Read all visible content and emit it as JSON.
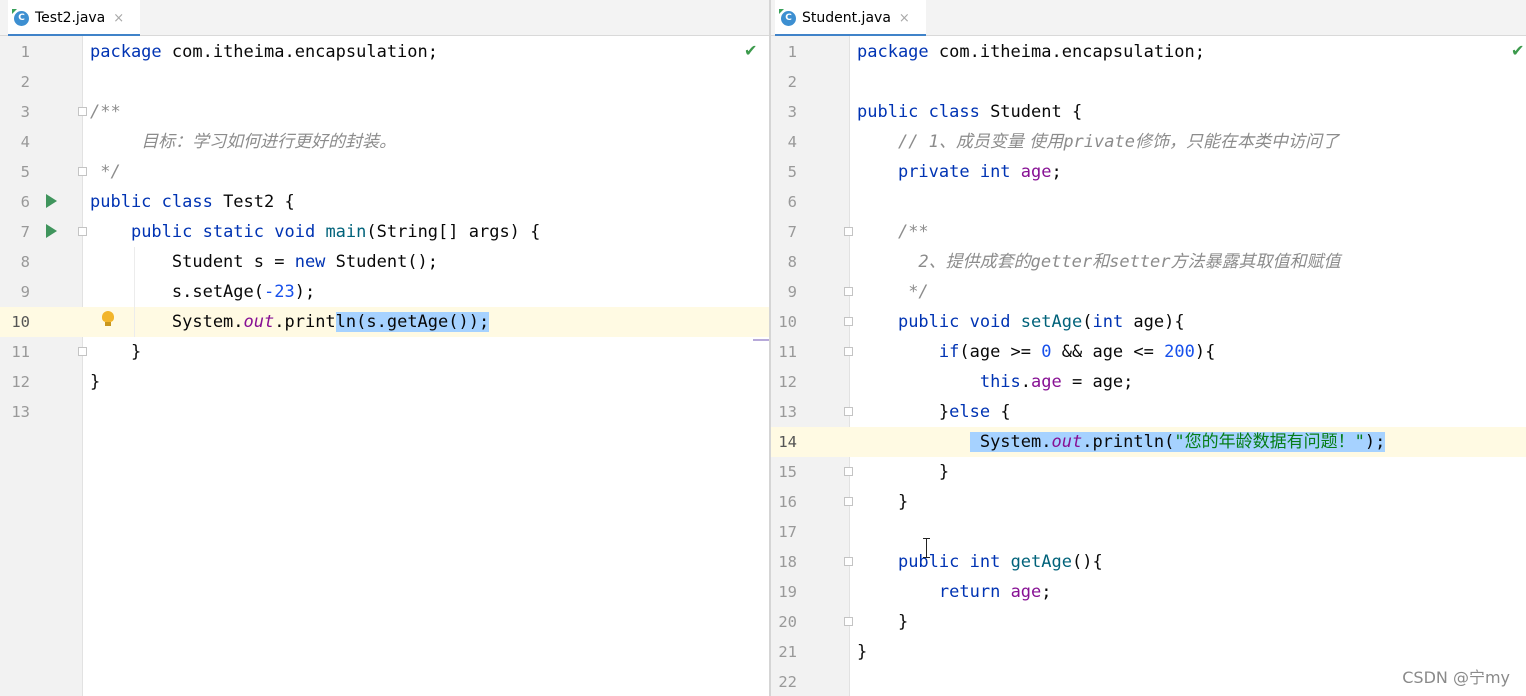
{
  "left": {
    "tab": {
      "label": "Test2.java",
      "close": "×"
    },
    "current_line": 10,
    "lines": [
      {
        "n": "1",
        "tokens": [
          {
            "c": "kw",
            "t": "package"
          },
          {
            "t": " com.itheima.encapsulation;"
          }
        ]
      },
      {
        "n": "2",
        "tokens": []
      },
      {
        "n": "3",
        "tokens": [
          {
            "c": "cm",
            "t": "/**"
          }
        ]
      },
      {
        "n": "4",
        "tokens": [
          {
            "c": "cm",
            "t": "     "
          },
          {
            "c": "cm cjk",
            "t": "目标：学习如何进行更好的封装。"
          }
        ]
      },
      {
        "n": "5",
        "tokens": [
          {
            "c": "cm",
            "t": " */"
          }
        ]
      },
      {
        "n": "6",
        "tokens": [
          {
            "c": "kw",
            "t": "public class"
          },
          {
            "t": " Test2 {"
          }
        ]
      },
      {
        "n": "7",
        "tokens": [
          {
            "t": "    "
          },
          {
            "c": "kw",
            "t": "public static void"
          },
          {
            "t": " "
          },
          {
            "c": "fn",
            "t": "main"
          },
          {
            "t": "(String[] args) {"
          }
        ]
      },
      {
        "n": "8",
        "tokens": [
          {
            "t": "        Student s = "
          },
          {
            "c": "kw",
            "t": "new"
          },
          {
            "t": " Student();"
          }
        ]
      },
      {
        "n": "9",
        "tokens": [
          {
            "t": "        s.setAge("
          },
          {
            "c": "num",
            "t": "-23"
          },
          {
            "t": ");"
          }
        ]
      },
      {
        "n": "10",
        "tokens": [
          {
            "t": "        System."
          },
          {
            "c": "st",
            "t": "out"
          },
          {
            "t": ".print"
          },
          {
            "c": "sel",
            "t": "ln(s.getAge());"
          }
        ]
      },
      {
        "n": "11",
        "tokens": [
          {
            "t": "    }"
          }
        ]
      },
      {
        "n": "12",
        "tokens": [
          {
            "t": "}"
          }
        ]
      },
      {
        "n": "13",
        "tokens": []
      }
    ]
  },
  "right": {
    "tab": {
      "label": "Student.java",
      "close": "×"
    },
    "current_line": 14,
    "lines": [
      {
        "n": "1",
        "tokens": [
          {
            "c": "kw",
            "t": "package"
          },
          {
            "t": " com.itheima.encapsulation;"
          }
        ]
      },
      {
        "n": "2",
        "tokens": []
      },
      {
        "n": "3",
        "tokens": [
          {
            "c": "kw",
            "t": "public class"
          },
          {
            "t": " Student {"
          }
        ]
      },
      {
        "n": "4",
        "tokens": [
          {
            "t": "    "
          },
          {
            "c": "cm",
            "t": "// 1"
          },
          {
            "c": "cm cjk",
            "t": "、成员变量 使用"
          },
          {
            "c": "cm",
            "t": "private"
          },
          {
            "c": "cm cjk",
            "t": "修饰，只能在本类中访问了"
          }
        ]
      },
      {
        "n": "5",
        "tokens": [
          {
            "t": "    "
          },
          {
            "c": "kw",
            "t": "private int"
          },
          {
            "t": " "
          },
          {
            "c": "fld",
            "t": "age"
          },
          {
            "t": ";"
          }
        ]
      },
      {
        "n": "6",
        "tokens": []
      },
      {
        "n": "7",
        "tokens": [
          {
            "t": "    "
          },
          {
            "c": "cm",
            "t": "/**"
          }
        ]
      },
      {
        "n": "8",
        "tokens": [
          {
            "t": "      "
          },
          {
            "c": "cm",
            "t": "2"
          },
          {
            "c": "cm cjk",
            "t": "、提供成套的"
          },
          {
            "c": "cm",
            "t": "getter"
          },
          {
            "c": "cm cjk",
            "t": "和"
          },
          {
            "c": "cm",
            "t": "setter"
          },
          {
            "c": "cm cjk",
            "t": "方法暴露其取值和赋值"
          }
        ]
      },
      {
        "n": "9",
        "tokens": [
          {
            "t": "     "
          },
          {
            "c": "cm",
            "t": "*/"
          }
        ]
      },
      {
        "n": "10",
        "tokens": [
          {
            "t": "    "
          },
          {
            "c": "kw",
            "t": "public void"
          },
          {
            "t": " "
          },
          {
            "c": "fn",
            "t": "setAge"
          },
          {
            "t": "("
          },
          {
            "c": "kw",
            "t": "int"
          },
          {
            "t": " age){"
          }
        ]
      },
      {
        "n": "11",
        "tokens": [
          {
            "t": "        "
          },
          {
            "c": "kw",
            "t": "if"
          },
          {
            "t": "(age >= "
          },
          {
            "c": "num",
            "t": "0"
          },
          {
            "t": " && age <= "
          },
          {
            "c": "num",
            "t": "200"
          },
          {
            "t": "){"
          }
        ]
      },
      {
        "n": "12",
        "tokens": [
          {
            "t": "            "
          },
          {
            "c": "kw",
            "t": "this"
          },
          {
            "t": "."
          },
          {
            "c": "fld",
            "t": "age"
          },
          {
            "t": " = age;"
          }
        ]
      },
      {
        "n": "13",
        "tokens": [
          {
            "t": "        }"
          },
          {
            "c": "kw",
            "t": "else"
          },
          {
            "t": " {"
          }
        ]
      },
      {
        "n": "14",
        "tokens": [
          {
            "t": "           "
          },
          {
            "c": "sel",
            "t": " System."
          },
          {
            "c": "sel st",
            "t": "out"
          },
          {
            "c": "sel",
            "t": ".println("
          },
          {
            "c": "sel str",
            "t": "\""
          },
          {
            "c": "sel str cjk",
            "t": "您的年龄数据有问题！"
          },
          {
            "c": "sel str",
            "t": "\""
          },
          {
            "c": "sel",
            "t": ");"
          }
        ]
      },
      {
        "n": "15",
        "tokens": [
          {
            "t": "        }"
          }
        ]
      },
      {
        "n": "16",
        "tokens": [
          {
            "t": "    }"
          }
        ]
      },
      {
        "n": "17",
        "tokens": []
      },
      {
        "n": "18",
        "tokens": [
          {
            "t": "    "
          },
          {
            "c": "kw",
            "t": "public int"
          },
          {
            "t": " "
          },
          {
            "c": "fn",
            "t": "getAge"
          },
          {
            "t": "(){"
          }
        ]
      },
      {
        "n": "19",
        "tokens": [
          {
            "t": "        "
          },
          {
            "c": "kw",
            "t": "return"
          },
          {
            "t": " "
          },
          {
            "c": "fld",
            "t": "age"
          },
          {
            "t": ";"
          }
        ]
      },
      {
        "n": "20",
        "tokens": [
          {
            "t": "    }"
          }
        ]
      },
      {
        "n": "21",
        "tokens": [
          {
            "t": "}"
          }
        ]
      },
      {
        "n": "22",
        "tokens": []
      }
    ]
  },
  "icons": {
    "file_icon": "java-class-icon",
    "run": "run-gutter-icon",
    "fold": "fold-marker-icon",
    "intention": "lightbulb-icon",
    "inspection_ok": "checkmark-icon",
    "check_glyph": "✔"
  },
  "colors": {
    "keyword": "#0033b3",
    "field": "#871094",
    "number": "#1750eb",
    "string": "#067d17",
    "comment": "#8c8c8c",
    "selection": "#a6d2ff",
    "current_line": "#fffae3"
  },
  "watermark": "CSDN @宁my"
}
